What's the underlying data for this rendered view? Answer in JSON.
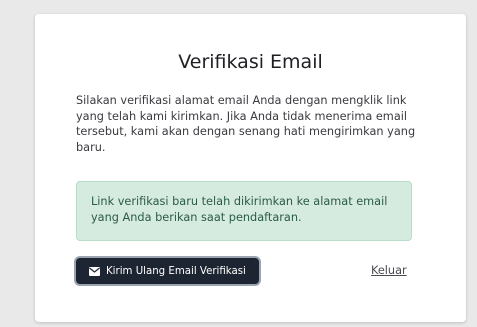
{
  "card": {
    "title": "Verifikasi Email",
    "description": "Silakan verifikasi alamat email Anda dengan mengklik link yang telah kami kirimkan. Jika Anda tidak menerima email tersebut, kami akan dengan senang hati mengirimkan yang baru.",
    "alert_message": "Link verifikasi baru telah dikirimkan ke alamat email yang Anda berikan saat pendaftaran.",
    "resend_button_label": "Kirim Ulang Email Verifikasi",
    "logout_label": "Keluar"
  },
  "icons": {
    "resend_button_icon": "envelope-icon"
  },
  "colors": {
    "page_background": "#e9e9ea",
    "card_background": "#ffffff",
    "alert_background": "#d5ebe0",
    "alert_text": "#2c5b45",
    "button_background": "#1e2532",
    "button_text": "#ffffff"
  }
}
